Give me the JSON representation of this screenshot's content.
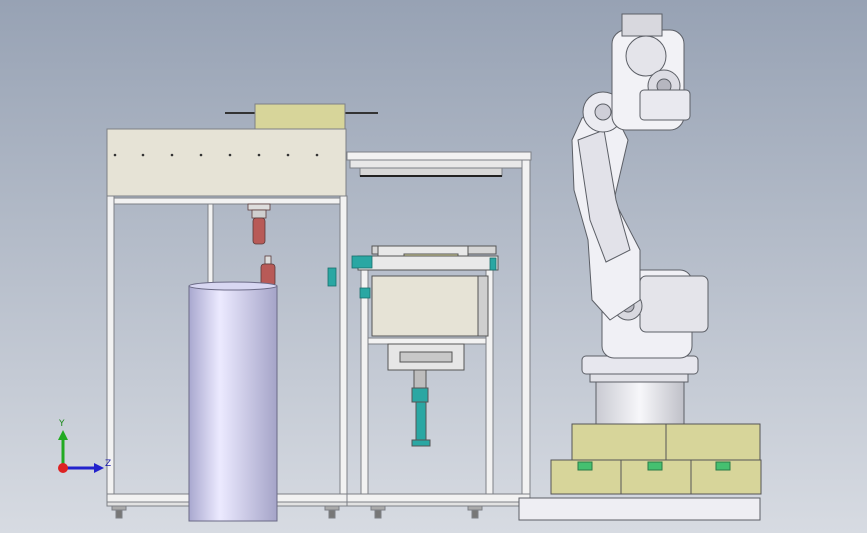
{
  "colors": {
    "background_top": "#97a2b4",
    "background_bottom": "#d7dbe2",
    "frame": "#f2f2f2",
    "frame_line": "#7d8086",
    "panel": "#e6e3d6",
    "yellow_box": "#d7d59a",
    "cylinder": "#c9c8e8",
    "teal": "#2aa7a3",
    "red": "#b85a57",
    "green": "#45c070",
    "robot": "#eeeef3",
    "robot_line": "#5c5f66",
    "axis_x": "#2222cc",
    "axis_y": "#22aa22",
    "axis_origin": "#dd2222"
  },
  "triad": {
    "y_label": "Y",
    "z_label": "Z"
  }
}
